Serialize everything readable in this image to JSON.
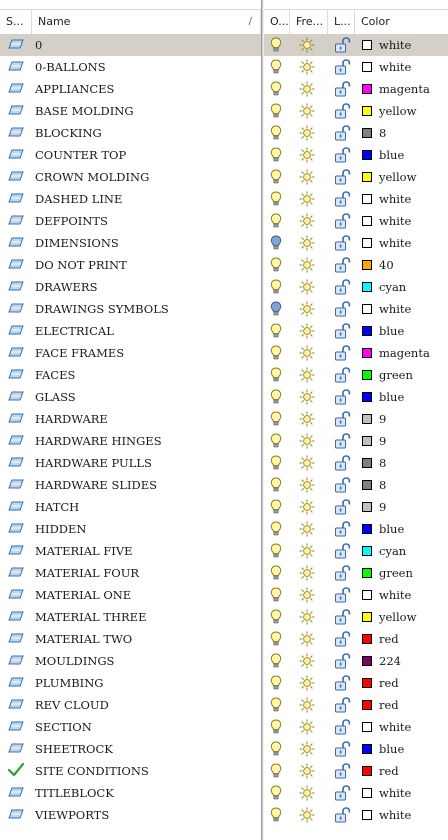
{
  "columns": {
    "status": "S...",
    "name": "Name",
    "on": "O...",
    "freeze": "Fre...",
    "lock": "L...",
    "color": "Color"
  },
  "layers": [
    {
      "status": "layer-icon",
      "name": "0",
      "on_state": "bulb-on-icon",
      "color_name": "white",
      "swatch": "#ffffff"
    },
    {
      "status": "layer-icon",
      "name": "0-BALLONS",
      "on_state": "bulb-on-icon",
      "color_name": "white",
      "swatch": "#ffffff"
    },
    {
      "status": "layer-icon",
      "name": "APPLIANCES",
      "on_state": "bulb-on-icon",
      "color_name": "magenta",
      "swatch": "#ff00ff"
    },
    {
      "status": "layer-icon",
      "name": "BASE MOLDING",
      "on_state": "bulb-on-icon",
      "color_name": "yellow",
      "swatch": "#ffff00"
    },
    {
      "status": "layer-icon",
      "name": "BLOCKING",
      "on_state": "bulb-on-icon",
      "color_name": "8",
      "swatch": "#808080"
    },
    {
      "status": "layer-icon",
      "name": "COUNTER TOP",
      "on_state": "bulb-on-icon",
      "color_name": "blue",
      "swatch": "#0000ff"
    },
    {
      "status": "layer-icon",
      "name": "CROWN MOLDING",
      "on_state": "bulb-on-icon",
      "color_name": "yellow",
      "swatch": "#ffff00"
    },
    {
      "status": "layer-icon",
      "name": "DASHED LINE",
      "on_state": "bulb-on-icon",
      "color_name": "white",
      "swatch": "#ffffff"
    },
    {
      "status": "layer-icon",
      "name": "DEFPOINTS",
      "on_state": "bulb-on-icon",
      "color_name": "white",
      "swatch": "#ffffff"
    },
    {
      "status": "layer-icon",
      "name": "DIMENSIONS",
      "on_state": "bulb-off-icon",
      "color_name": "white",
      "swatch": "#ffffff"
    },
    {
      "status": "layer-icon",
      "name": "DO NOT PRINT",
      "on_state": "bulb-on-icon",
      "color_name": "40",
      "swatch": "#ffaa00"
    },
    {
      "status": "layer-icon",
      "name": "DRAWERS",
      "on_state": "bulb-on-icon",
      "color_name": "cyan",
      "swatch": "#00ffff"
    },
    {
      "status": "layer-icon",
      "name": "DRAWINGS SYMBOLS",
      "on_state": "bulb-off-icon",
      "color_name": "white",
      "swatch": "#ffffff"
    },
    {
      "status": "layer-icon",
      "name": "ELECTRICAL",
      "on_state": "bulb-on-icon",
      "color_name": "blue",
      "swatch": "#0000ff"
    },
    {
      "status": "layer-icon",
      "name": "FACE FRAMES",
      "on_state": "bulb-on-icon",
      "color_name": "magenta",
      "swatch": "#ff00ff"
    },
    {
      "status": "layer-icon",
      "name": "FACES",
      "on_state": "bulb-on-icon",
      "color_name": "green",
      "swatch": "#00ff00"
    },
    {
      "status": "layer-icon",
      "name": "GLASS",
      "on_state": "bulb-on-icon",
      "color_name": "blue",
      "swatch": "#0000ff"
    },
    {
      "status": "layer-icon",
      "name": "HARDWARE",
      "on_state": "bulb-on-icon",
      "color_name": "9",
      "swatch": "#c0c0c0"
    },
    {
      "status": "layer-icon",
      "name": "HARDWARE HINGES",
      "on_state": "bulb-on-icon",
      "color_name": "9",
      "swatch": "#c0c0c0"
    },
    {
      "status": "layer-icon",
      "name": "HARDWARE PULLS",
      "on_state": "bulb-on-icon",
      "color_name": "8",
      "swatch": "#808080"
    },
    {
      "status": "layer-icon",
      "name": "HARDWARE SLIDES",
      "on_state": "bulb-on-icon",
      "color_name": "8",
      "swatch": "#808080"
    },
    {
      "status": "layer-icon",
      "name": "HATCH",
      "on_state": "bulb-on-icon",
      "color_name": "9",
      "swatch": "#c0c0c0"
    },
    {
      "status": "layer-icon",
      "name": "HIDDEN",
      "on_state": "bulb-on-icon",
      "color_name": "blue",
      "swatch": "#0000ff"
    },
    {
      "status": "layer-icon",
      "name": "MATERIAL FIVE",
      "on_state": "bulb-on-icon",
      "color_name": "cyan",
      "swatch": "#00ffff"
    },
    {
      "status": "layer-icon",
      "name": "MATERIAL FOUR",
      "on_state": "bulb-on-icon",
      "color_name": "green",
      "swatch": "#00ff00"
    },
    {
      "status": "layer-icon",
      "name": "MATERIAL ONE",
      "on_state": "bulb-on-icon",
      "color_name": "white",
      "swatch": "#ffffff"
    },
    {
      "status": "layer-icon",
      "name": "MATERIAL THREE",
      "on_state": "bulb-on-icon",
      "color_name": "yellow",
      "swatch": "#ffff00"
    },
    {
      "status": "layer-icon",
      "name": "MATERIAL TWO",
      "on_state": "bulb-on-icon",
      "color_name": "red",
      "swatch": "#ff0000"
    },
    {
      "status": "layer-icon",
      "name": "MOULDINGS",
      "on_state": "bulb-on-icon",
      "color_name": "224",
      "swatch": "#7f005f"
    },
    {
      "status": "layer-icon",
      "name": "PLUMBING",
      "on_state": "bulb-on-icon",
      "color_name": "red",
      "swatch": "#ff0000"
    },
    {
      "status": "layer-icon",
      "name": "REV CLOUD",
      "on_state": "bulb-on-icon",
      "color_name": "red",
      "swatch": "#ff0000"
    },
    {
      "status": "layer-icon",
      "name": "SECTION",
      "on_state": "bulb-on-icon",
      "color_name": "white",
      "swatch": "#ffffff"
    },
    {
      "status": "layer-icon",
      "name": "SHEETROCK",
      "on_state": "bulb-on-icon",
      "color_name": "blue",
      "swatch": "#0000ff"
    },
    {
      "status": "checkmark-icon",
      "name": "SITE CONDITIONS",
      "on_state": "bulb-on-icon",
      "color_name": "red",
      "swatch": "#ff0000"
    },
    {
      "status": "layer-icon",
      "name": "TITLEBLOCK",
      "on_state": "bulb-on-icon",
      "color_name": "white",
      "swatch": "#ffffff"
    },
    {
      "status": "layer-icon",
      "name": "VIEWPORTS",
      "on_state": "bulb-on-icon",
      "color_name": "white",
      "swatch": "#ffffff"
    }
  ],
  "selected_index": 0
}
